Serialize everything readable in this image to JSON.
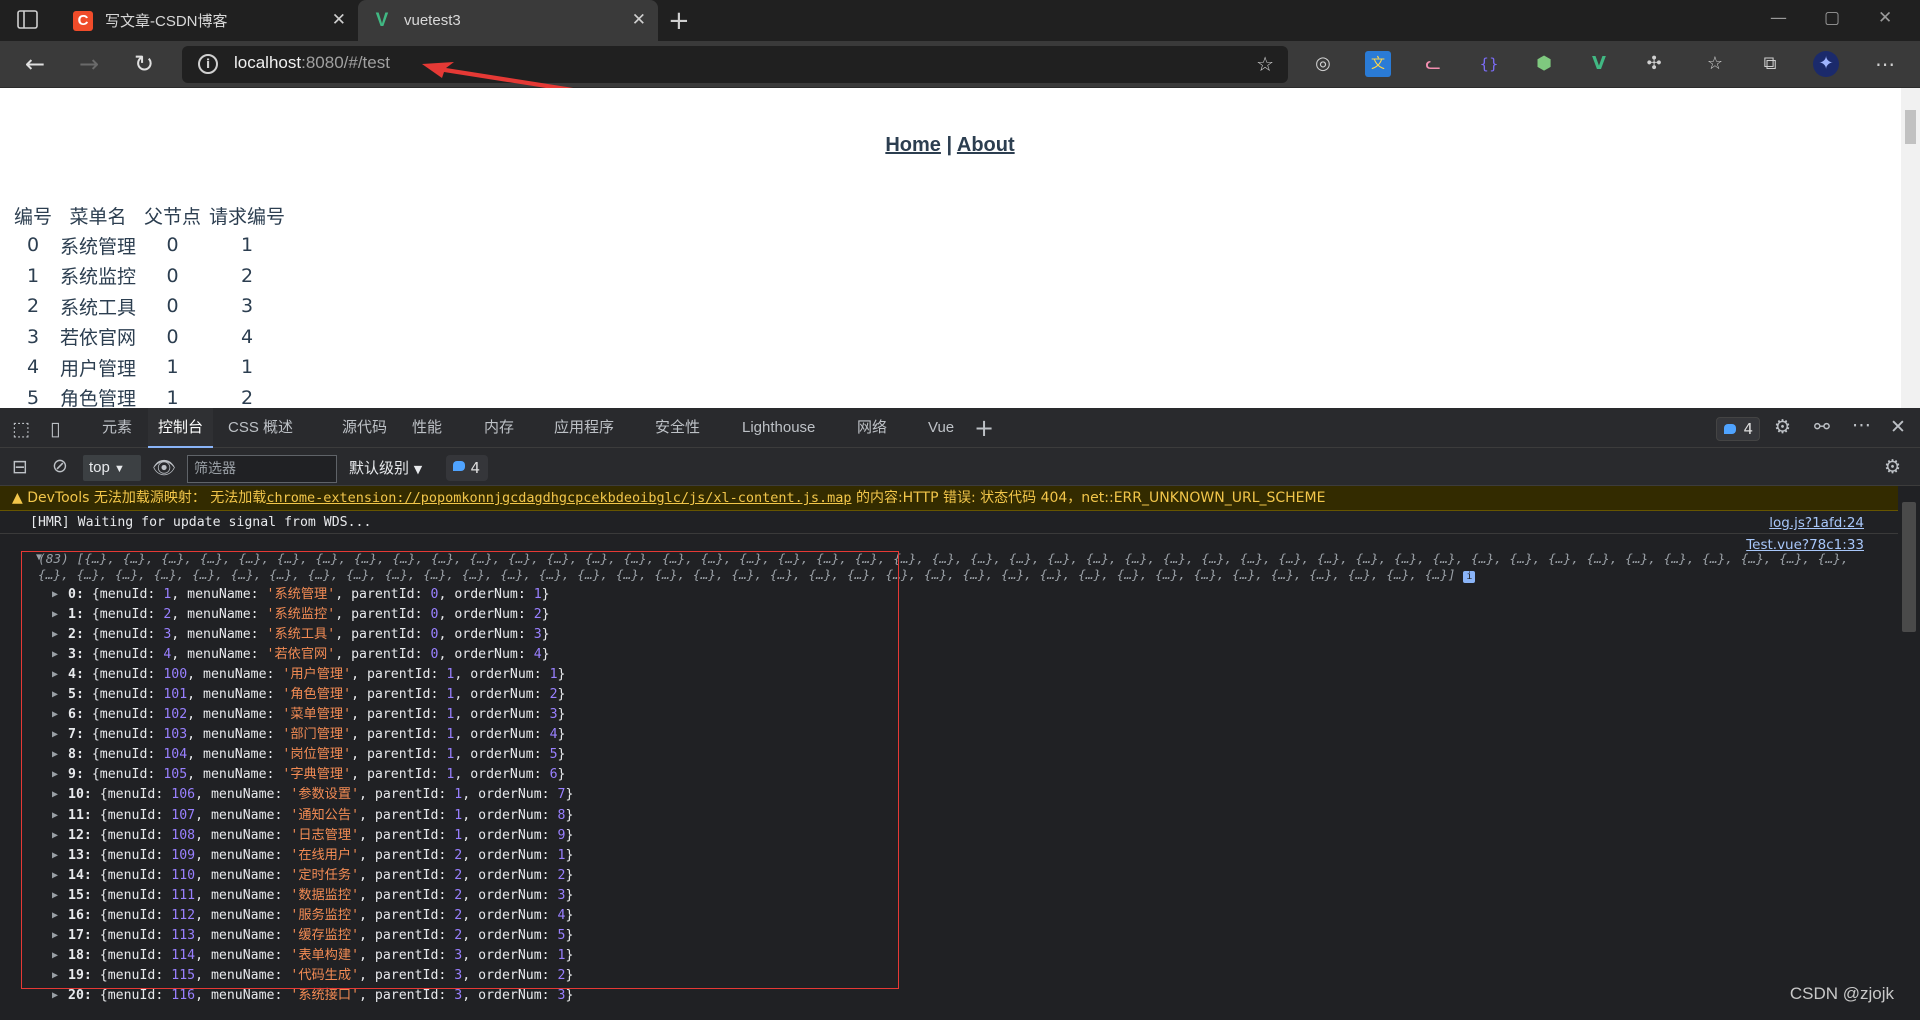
{
  "browser": {
    "tabs": [
      {
        "title": "写文章-CSDN博客",
        "favicon": "csdn-icon",
        "favicon_char": "C",
        "favicon_bg": "#f04c2a",
        "close": "✕"
      },
      {
        "title": "vuetest3",
        "favicon": "vue-icon",
        "favicon_char": "V",
        "favicon_bg": "transparent",
        "close": "✕"
      }
    ],
    "new_tab": "+",
    "window_controls": {
      "minimize": "—",
      "maximize": "▢",
      "close": "✕"
    },
    "url_host": "localhost",
    "url_rest": ":8080/#/test"
  },
  "page": {
    "nav": {
      "home": "Home",
      "separator": " | ",
      "about": "About"
    },
    "table": {
      "headers": [
        "编号",
        "菜单名",
        "父节点",
        "请求编号"
      ],
      "rows": [
        [
          "0",
          "系统管理",
          "0",
          "1"
        ],
        [
          "1",
          "系统监控",
          "0",
          "2"
        ],
        [
          "2",
          "系统工具",
          "0",
          "3"
        ],
        [
          "3",
          "若依官网",
          "0",
          "4"
        ],
        [
          "4",
          "用户管理",
          "1",
          "1"
        ],
        [
          "5",
          "角色管理",
          "1",
          "2"
        ]
      ]
    }
  },
  "devtools": {
    "tabs": [
      "元素",
      "控制台",
      "CSS 概述",
      "源代码",
      "性能",
      "内存",
      "应用程序",
      "安全性",
      "Lighthouse",
      "网络",
      "Vue"
    ],
    "active_tab": "控制台",
    "issues_badge": "4",
    "context": "top",
    "filter_placeholder": "筛选器",
    "level": "默认级别",
    "console_badge": "4",
    "warning": {
      "prefix": "DevTools 无法加载源映射： 无法加载",
      "link": "chrome-extension://popomkonnjgcdagdhgcpcekbdeoibglc/js/xl-content.js.map",
      "suffix": " 的内容:HTTP 错误: 状态代码 404，net::ERR_UNKNOWN_URL_SCHEME"
    },
    "hmr": {
      "text": "[HMR] Waiting for update signal from WDS...",
      "source": "log.js?1afd:24"
    },
    "array_source": "Test.vue?78c1:33",
    "array_count": "(83)",
    "array_summary": "[{…}, {…}, {…}, {…}, {…}, {…}, {…}, {…}, {…}, {…}, {…}, {…}, {…}, {…}, {…}, {…}, {…}, {…}, {…}, {…}, {…}, {…}, {…}, {…}, {…}, {…}, {…}, {…}, {…}, {…}, {…}, {…}, {…}, {…}, {…}, {…}, {…}, {…}, {…}, {…}, {…}, {…}, {…}, {…}, {…}, {…}, {…}, {…}, {…}, {…}, {…}, {…}, {…}, {…}, {…}, {…}, {…}, {…}, {…}, {…}, {…}, {…}, {…}, {…}, {…}, {…}, {…}, {…}, {…}, {…}, {…}, {…}, {…}, {…}, {…}, {…}, {…}, {…}, {…}, {…}, {…}, {…}, {…}]",
    "items": [
      {
        "i": "0",
        "menuId": "1",
        "menuName": "系统管理",
        "parentId": "0",
        "orderNum": "1"
      },
      {
        "i": "1",
        "menuId": "2",
        "menuName": "系统监控",
        "parentId": "0",
        "orderNum": "2"
      },
      {
        "i": "2",
        "menuId": "3",
        "menuName": "系统工具",
        "parentId": "0",
        "orderNum": "3"
      },
      {
        "i": "3",
        "menuId": "4",
        "menuName": "若依官网",
        "parentId": "0",
        "orderNum": "4"
      },
      {
        "i": "4",
        "menuId": "100",
        "menuName": "用户管理",
        "parentId": "1",
        "orderNum": "1"
      },
      {
        "i": "5",
        "menuId": "101",
        "menuName": "角色管理",
        "parentId": "1",
        "orderNum": "2"
      },
      {
        "i": "6",
        "menuId": "102",
        "menuName": "菜单管理",
        "parentId": "1",
        "orderNum": "3"
      },
      {
        "i": "7",
        "menuId": "103",
        "menuName": "部门管理",
        "parentId": "1",
        "orderNum": "4"
      },
      {
        "i": "8",
        "menuId": "104",
        "menuName": "岗位管理",
        "parentId": "1",
        "orderNum": "5"
      },
      {
        "i": "9",
        "menuId": "105",
        "menuName": "字典管理",
        "parentId": "1",
        "orderNum": "6"
      },
      {
        "i": "10",
        "menuId": "106",
        "menuName": "参数设置",
        "parentId": "1",
        "orderNum": "7"
      },
      {
        "i": "11",
        "menuId": "107",
        "menuName": "通知公告",
        "parentId": "1",
        "orderNum": "8"
      },
      {
        "i": "12",
        "menuId": "108",
        "menuName": "日志管理",
        "parentId": "1",
        "orderNum": "9"
      },
      {
        "i": "13",
        "menuId": "109",
        "menuName": "在线用户",
        "parentId": "2",
        "orderNum": "1"
      },
      {
        "i": "14",
        "menuId": "110",
        "menuName": "定时任务",
        "parentId": "2",
        "orderNum": "2"
      },
      {
        "i": "15",
        "menuId": "111",
        "menuName": "数据监控",
        "parentId": "2",
        "orderNum": "3"
      },
      {
        "i": "16",
        "menuId": "112",
        "menuName": "服务监控",
        "parentId": "2",
        "orderNum": "4"
      },
      {
        "i": "17",
        "menuId": "113",
        "menuName": "缓存监控",
        "parentId": "2",
        "orderNum": "5"
      },
      {
        "i": "18",
        "menuId": "114",
        "menuName": "表单构建",
        "parentId": "3",
        "orderNum": "1"
      },
      {
        "i": "19",
        "menuId": "115",
        "menuName": "代码生成",
        "parentId": "3",
        "orderNum": "2"
      },
      {
        "i": "20",
        "menuId": "116",
        "menuName": "系统接口",
        "parentId": "3",
        "orderNum": "3"
      }
    ]
  },
  "watermark": "CSDN @zjojk"
}
